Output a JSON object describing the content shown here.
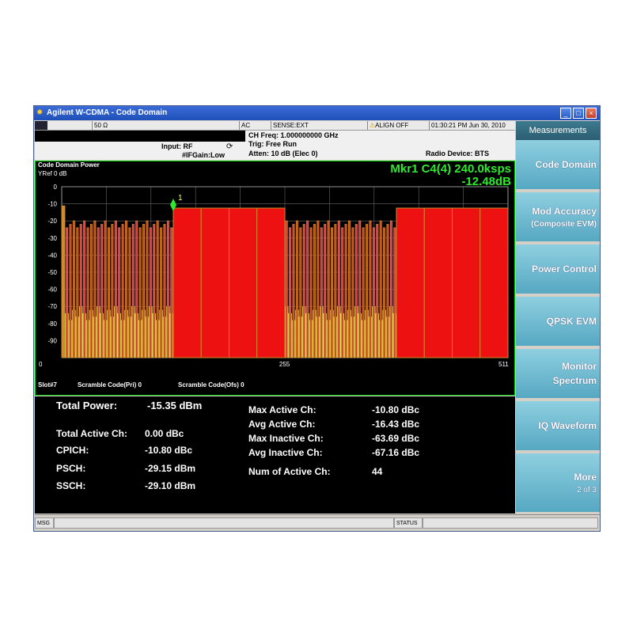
{
  "window": {
    "title": "Agilent W-CDMA - Code Domain",
    "min": "_",
    "max": "□",
    "close": "×"
  },
  "status_row": {
    "impedance": "50 Ω",
    "coupling": "AC",
    "sense": "SENSE:EXT",
    "align": "ALIGN OFF",
    "datetime": "01:30:21 PM Jun 30, 2010"
  },
  "info": {
    "input": "Input: RF",
    "ifgain": "#IFGain:Low",
    "ch_freq": "CH Freq: 1.000000000 GHz",
    "trig": "Trig: Free Run",
    "atten": "Atten: 10 dB (Elec 0)",
    "radio_device": "Radio Device: BTS"
  },
  "graph": {
    "title": "Code Domain Power",
    "yref": "YRef  0 dB",
    "marker_line1": "Mkr1 C4(4) 240.0ksps",
    "marker_line2": "-12.48dB",
    "marker_label": "1",
    "y_ticks": [
      "0",
      "-10",
      "-20",
      "-30",
      "-40",
      "-50",
      "-60",
      "-70",
      "-80",
      "-90"
    ],
    "x_ticks": [
      "0",
      "255",
      "511"
    ],
    "footer_slot": "Slot#7",
    "footer_pri": "Scramble Code(Pri) 0",
    "footer_ofs": "Scramble Code(Ofs) 0"
  },
  "chart_data": {
    "type": "bar",
    "xlabel": "",
    "ylabel": "",
    "xlim": [
      0,
      511
    ],
    "ylim": [
      -100,
      0
    ],
    "wide_blocks": [
      {
        "start": 128,
        "end": 160,
        "value": -12.5
      },
      {
        "start": 160,
        "end": 192,
        "value": -12.5
      },
      {
        "start": 192,
        "end": 224,
        "value": -12.5
      },
      {
        "start": 224,
        "end": 256,
        "value": -12.5
      },
      {
        "start": 384,
        "end": 416,
        "value": -12.5
      },
      {
        "start": 416,
        "end": 448,
        "value": -12.5
      },
      {
        "start": 448,
        "end": 480,
        "value": -12.5
      },
      {
        "start": 480,
        "end": 512,
        "value": -12.5
      }
    ],
    "narrow_regions": [
      {
        "start": 0,
        "end": 128,
        "active_value": -20
      },
      {
        "start": 256,
        "end": 384,
        "active_value": -20
      }
    ],
    "colors": {
      "active": "#ee1111",
      "active_edge": "#d08a2a",
      "inactive": "#c8ec4a",
      "first": "#d28a2a",
      "marker": "#2eea2e"
    }
  },
  "results": {
    "total_power_label": "Total Power:",
    "total_power": "-15.35 dBm",
    "total_active_label": "Total Active Ch:",
    "total_active": "0.00 dBc",
    "cpich_label": "CPICH:",
    "cpich": "-10.80 dBc",
    "psch_label": "PSCH:",
    "psch": "-29.15 dBm",
    "ssch_label": "SSCH:",
    "ssch": "-29.10 dBm",
    "max_active_label": "Max Active Ch:",
    "max_active": "-10.80 dBc",
    "avg_active_label": "Avg Active Ch:",
    "avg_active": "-16.43 dBc",
    "max_inactive_label": "Max Inactive Ch:",
    "max_inactive": "-63.69 dBc",
    "avg_inactive_label": "Avg Inactive Ch:",
    "avg_inactive": "-67.16 dBc",
    "num_active_label": "Num of Active Ch:",
    "num_active": "44"
  },
  "softkeys": {
    "header": "Measurements",
    "items": [
      {
        "label": "Code Domain",
        "sub": ""
      },
      {
        "label": "Mod Accuracy",
        "sub": "(Composite EVM)"
      },
      {
        "label": "Power Control",
        "sub": ""
      },
      {
        "label": "QPSK EVM",
        "sub": ""
      },
      {
        "label": "Monitor",
        "sub": "Spectrum"
      },
      {
        "label": "IQ Waveform",
        "sub": ""
      },
      {
        "label": "More",
        "sub": "2 of 3"
      }
    ]
  },
  "bottom": {
    "msg": "MSG",
    "status": "STATUS"
  }
}
